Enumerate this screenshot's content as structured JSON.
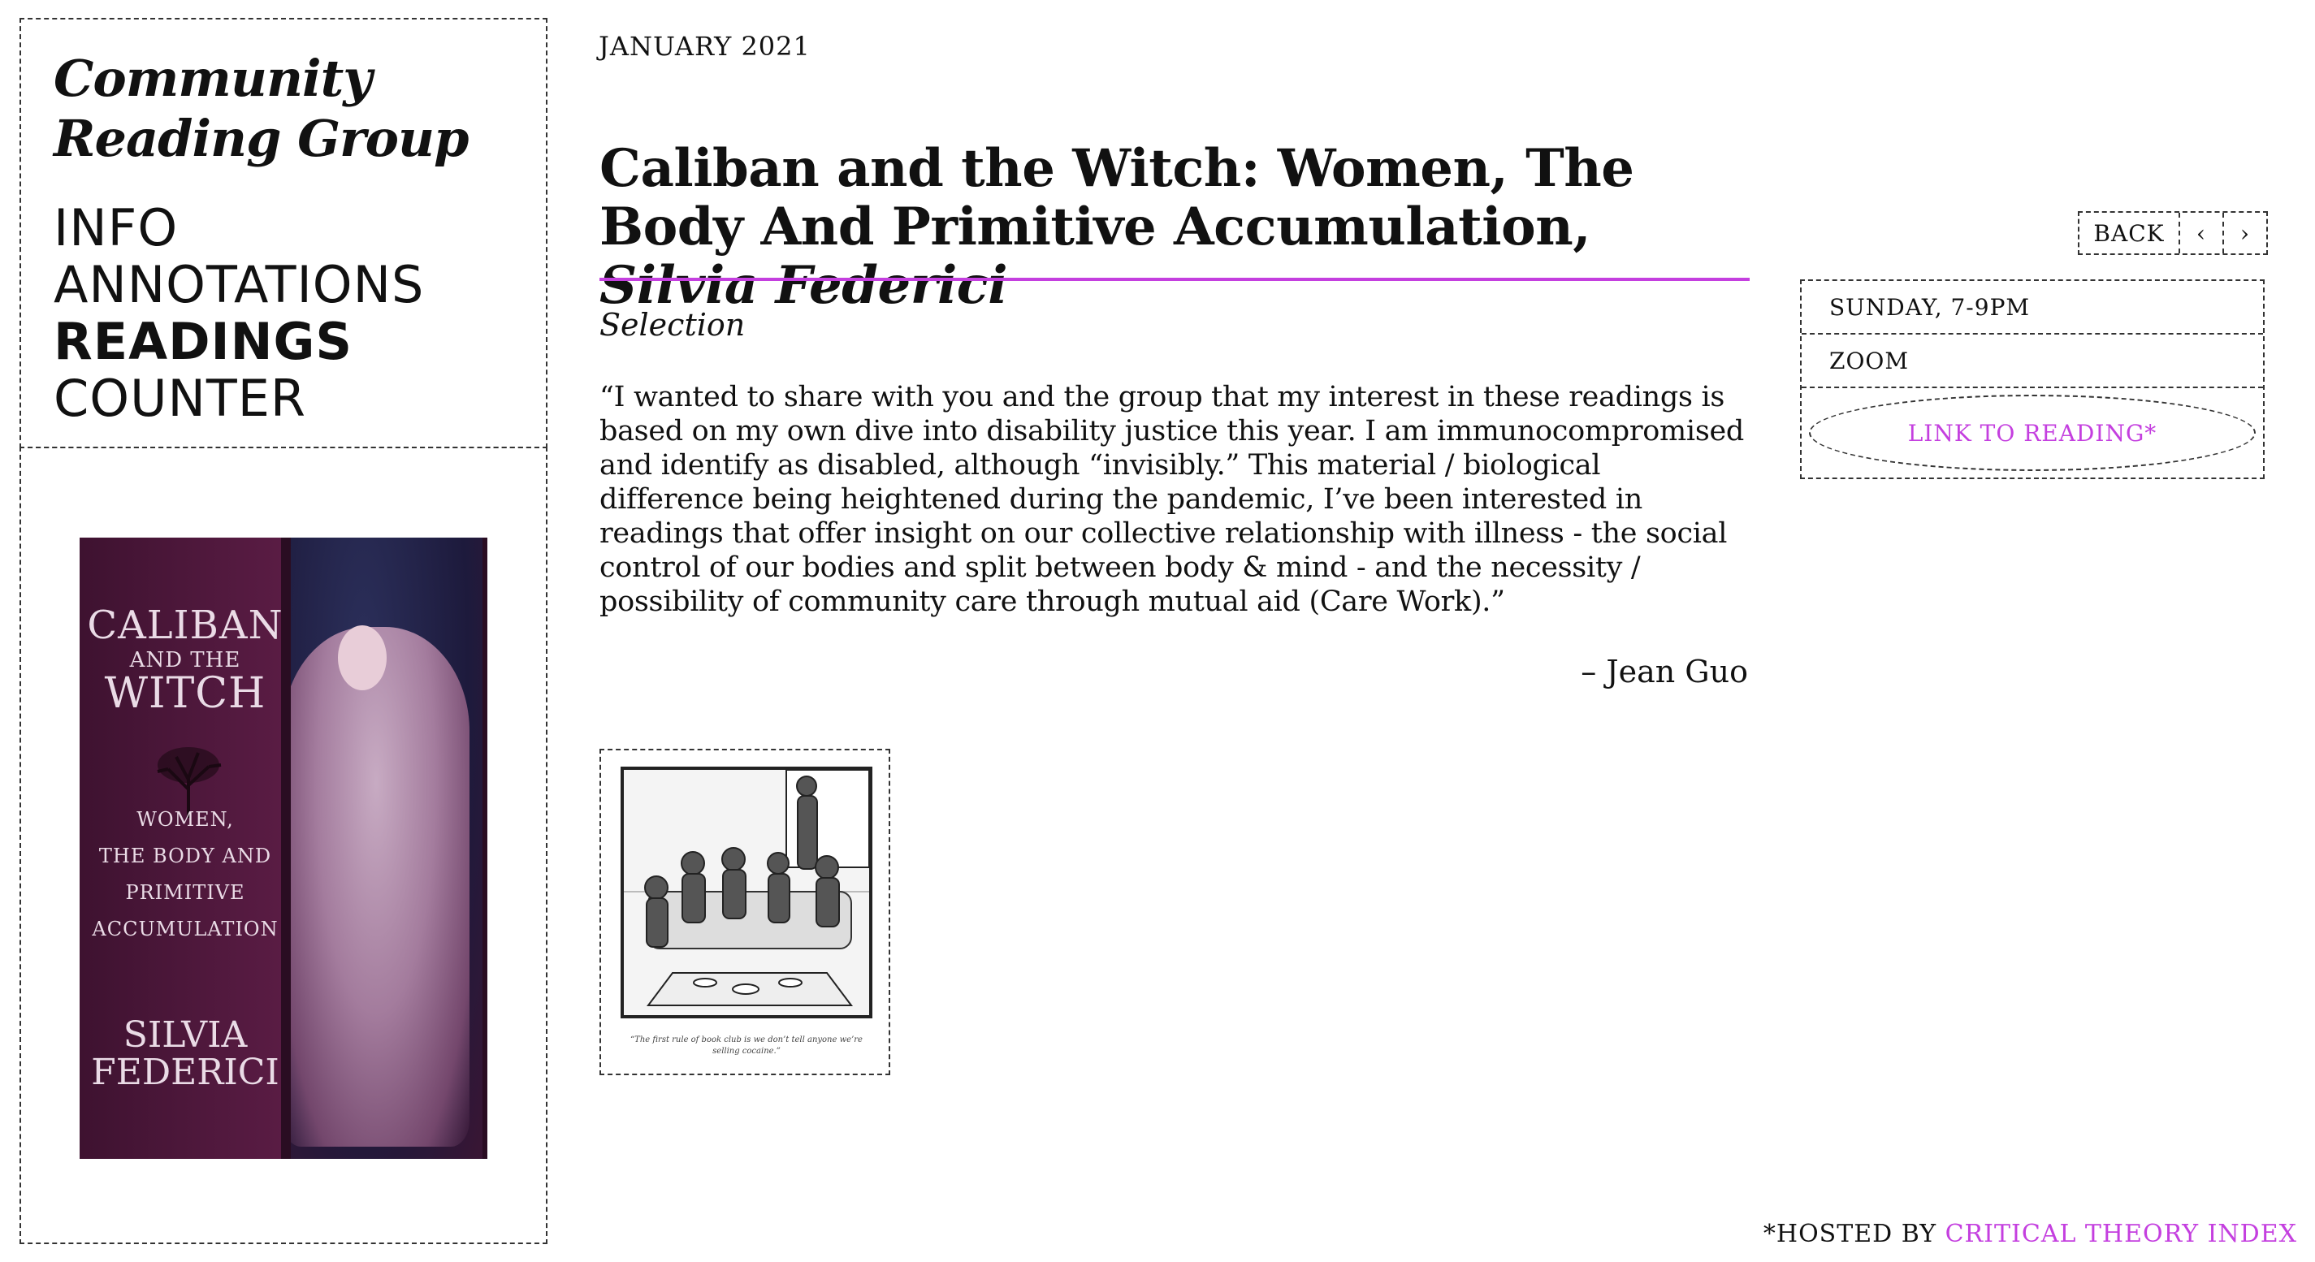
{
  "site": {
    "title_line1": "Community",
    "title_line2": "Reading Group"
  },
  "nav": {
    "items": [
      {
        "label": "INFO",
        "active": false
      },
      {
        "label": "ANNOTATIONS",
        "active": false
      },
      {
        "label": "READINGS",
        "active": true
      },
      {
        "label": "COUNTER",
        "active": false
      }
    ]
  },
  "cover": {
    "title_line1": "CALIBAN",
    "title_small": "AND THE",
    "title_line2": "WITCH",
    "subtitle_lines": [
      "WOMEN,",
      "THE BODY AND",
      "PRIMITIVE",
      "ACCUMULATION"
    ],
    "author_line1": "SILVIA",
    "author_line2": "FEDERICI"
  },
  "reading": {
    "date": "JANUARY 2021",
    "title": "Caliban and the Witch: Women, The Body And Primitive Accumulation,",
    "author": "Silvia Federici",
    "selection_label": "Selection",
    "quote": "“I wanted to share with you and the group that my interest in these readings is based on my own dive into disability justice this year. I am immunocompromised and identify as disabled, although “invisibly.” This material / biological difference being heightened during the pandemic, I’ve been interested in readings that offer insight on our collective relationship with illness - the social control of our bodies and split between body & mind - and the necessity / possibility of community care through mutual aid (Care Work).”",
    "attribution": "– Jean Guo",
    "cartoon_caption": "“The first rule of book club is we don’t tell anyone we’re selling cocaine.”"
  },
  "controls": {
    "back_label": "BACK",
    "prev_glyph": "‹",
    "next_glyph": "›"
  },
  "info": {
    "when": "SUNDAY, 7-9PM",
    "where": "ZOOM",
    "link_label": "LINK TO READING*"
  },
  "footer": {
    "prefix": "*HOSTED BY ",
    "link_label": "CRITICAL THEORY INDEX"
  },
  "colors": {
    "accent": "#c43fdf",
    "text": "#111111",
    "cover_bg": "#4a173b"
  }
}
